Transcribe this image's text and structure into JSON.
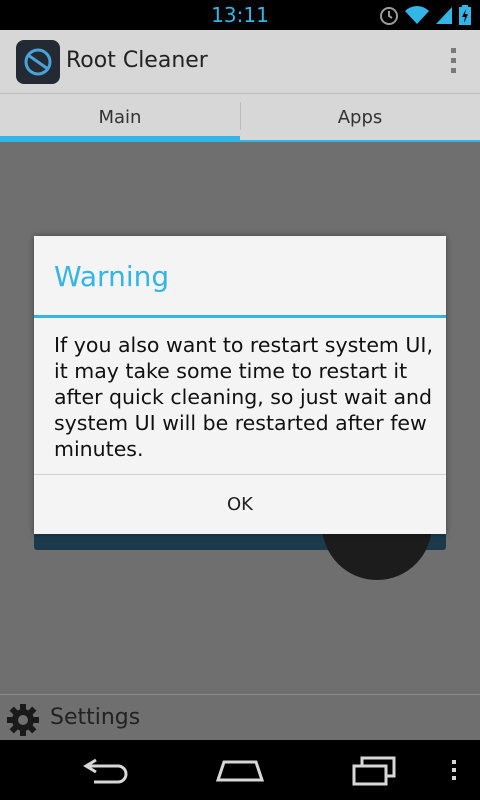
{
  "status_bar": {
    "time": "13:11",
    "icons": [
      "alarm-icon",
      "wifi-icon",
      "signal-icon",
      "battery-icon"
    ]
  },
  "action_bar": {
    "title": "Root Cleaner",
    "icon": "root-cleaner-app-icon",
    "overflow_icon": "overflow-menu-icon"
  },
  "tabs": [
    {
      "label": "Main",
      "selected": true
    },
    {
      "label": "Apps",
      "selected": false
    }
  ],
  "settings": {
    "label": "Settings",
    "icon": "gear-icon"
  },
  "dialog": {
    "title": "Warning",
    "message": "If you also want to restart system UI, it may take some time to restart it after quick cleaning, so just wait and system UI will be restarted after few minutes.",
    "ok_label": "OK"
  },
  "nav_bar": {
    "icons": [
      "back-icon",
      "home-icon",
      "recents-icon",
      "menu-icon"
    ]
  },
  "colors": {
    "accent": "#33b5e5",
    "action_bar": "#d7d7d7",
    "dim_background": "#6f6f6f"
  }
}
